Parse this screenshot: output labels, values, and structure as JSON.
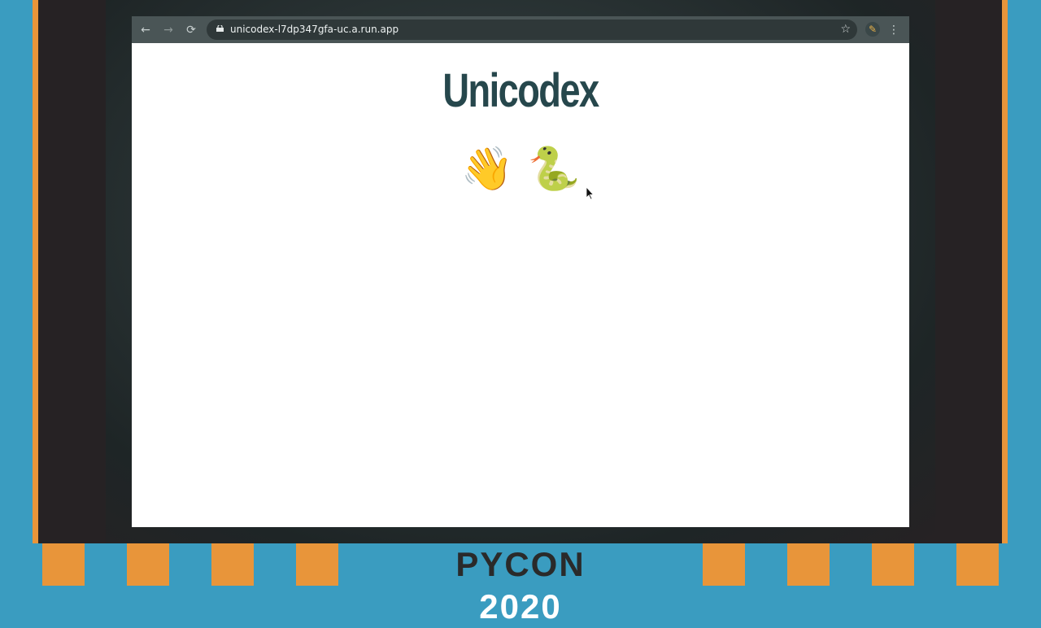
{
  "browser": {
    "url": "unicodex-l7dp347gfa-uc.a.run.app",
    "back_icon": "←",
    "reload_icon": "⟳",
    "star_icon": "☆",
    "menu_icon": "⋮",
    "extension_icon": "✎"
  },
  "page": {
    "title": "Unicodex",
    "emojis": [
      "👋",
      "🐍"
    ]
  },
  "footer": {
    "brand": "PYCON",
    "year": "2020"
  },
  "colors": {
    "accent_orange": "#e8953a",
    "accent_blue": "#3a9cc0",
    "title_color": "#26474c"
  }
}
